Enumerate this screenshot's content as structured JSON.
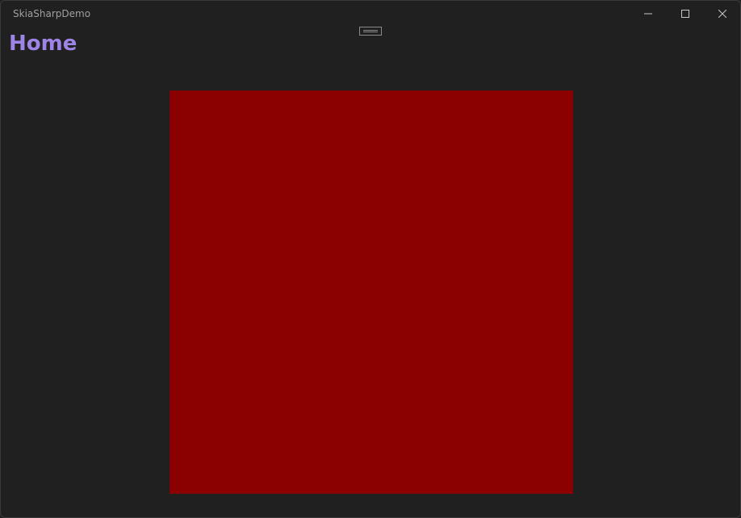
{
  "window": {
    "title": "SkiaSharpDemo",
    "caption_buttons": [
      {
        "name": "minimize",
        "icon": "minimize-icon"
      },
      {
        "name": "maximize",
        "icon": "maximize-icon"
      },
      {
        "name": "close",
        "icon": "close-icon"
      }
    ]
  },
  "page": {
    "title": "Home"
  },
  "canvas": {
    "fill_color": "#8b0000"
  },
  "colors": {
    "background": "#202020",
    "accent": "#9d84e6",
    "canvas_fill": "#8b0000"
  }
}
